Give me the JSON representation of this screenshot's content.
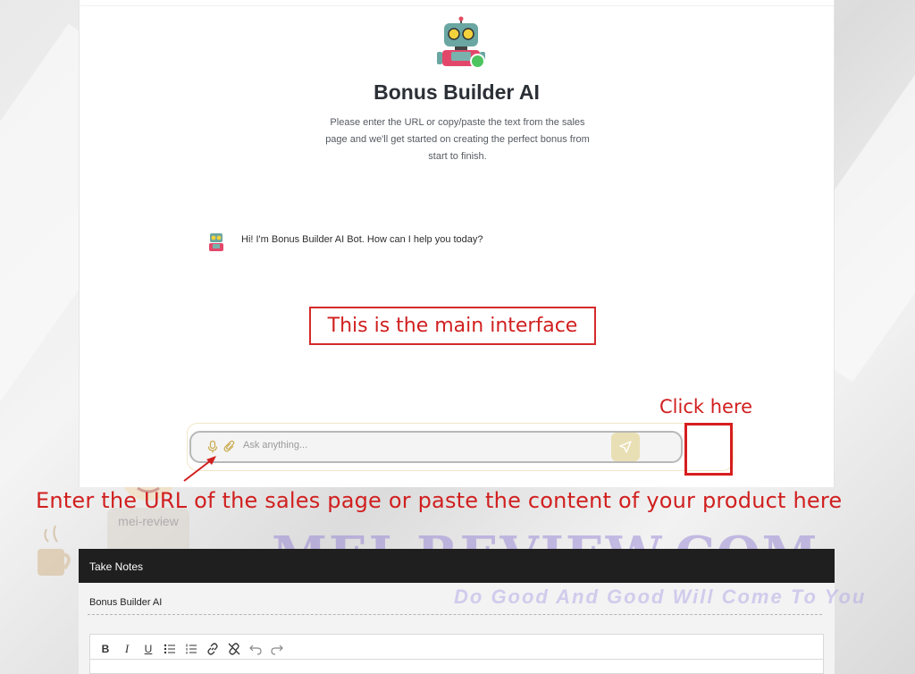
{
  "app": {
    "title": "Bonus Builder AI",
    "intro": "Please enter the URL or copy/paste the text from the sales page and we'll get started on creating the perfect bonus from start to finish.",
    "bot_message": "Hi! I'm Bonus Builder AI Bot. How can I help you today?",
    "input_placeholder": "Ask anything...",
    "status_color": "#4cc45f",
    "send_color": "#e9dfb4"
  },
  "annotations": {
    "main_interface": "This is the main interface",
    "click_here": "Click here",
    "enter_url": "Enter the URL of the sales page or paste the content of your product here",
    "color": "#d11f1f"
  },
  "watermark": {
    "name": "MEI-REVIEW.COM",
    "tagline": "Do Good And Good Will Come To You",
    "badge": "mei-review"
  },
  "notes": {
    "header": "Take Notes",
    "name_value": "Bonus Builder AI",
    "toolbar": {
      "bold": "B",
      "italic": "I",
      "underline": "U"
    }
  },
  "icons": [
    "robot-avatar",
    "mic-icon",
    "paperclip-icon",
    "send-icon",
    "bullet-list-icon",
    "numbered-list-icon",
    "link-icon",
    "unlink-icon",
    "undo-icon",
    "redo-icon"
  ]
}
